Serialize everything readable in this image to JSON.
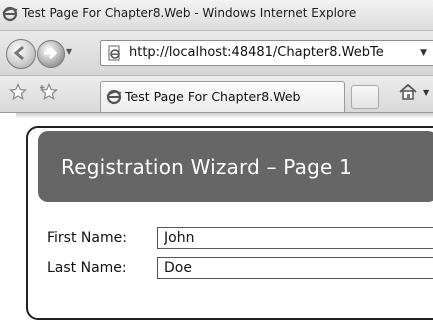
{
  "window": {
    "title": "Test Page For Chapter8.Web - Windows Internet Explore"
  },
  "navigation": {
    "address_url": "http://localhost:48481/Chapter8.WebTe"
  },
  "tabs": [
    {
      "label": "Test Page For Chapter8.Web",
      "active": true
    }
  ],
  "page": {
    "header_title": "Registration Wizard – Page 1",
    "header_bg": "#666666",
    "fields": [
      {
        "label": "First Name:",
        "value": "John"
      },
      {
        "label": "Last Name:",
        "value": "Doe"
      }
    ]
  }
}
